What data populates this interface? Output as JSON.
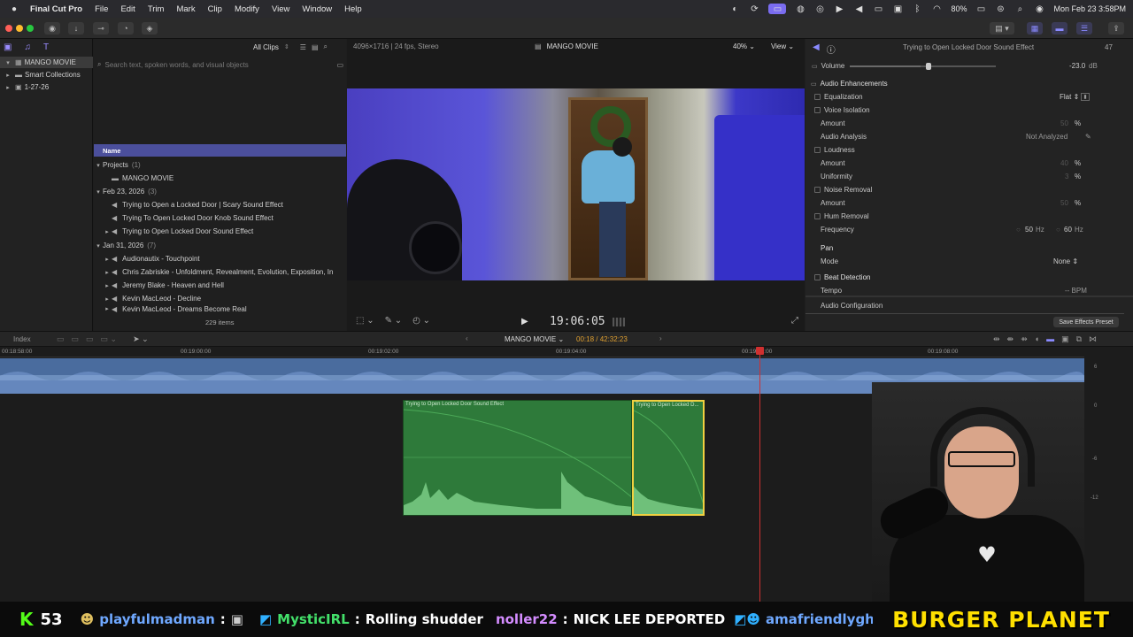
{
  "menubar": {
    "app_name": "Final Cut Pro",
    "items": [
      "File",
      "Edit",
      "Trim",
      "Mark",
      "Clip",
      "Modify",
      "View",
      "Window",
      "Help"
    ],
    "battery": "80%",
    "datetime": "Mon Feb 23  3:58PM"
  },
  "library": {
    "name": "MANGO MOVIE",
    "items": [
      "Smart Collections",
      "1-27-26"
    ]
  },
  "browser": {
    "filter_label": "All Clips",
    "search_placeholder": "Search text, spoken words, and visual objects",
    "column_header": "Name",
    "item_count": "229 items",
    "groups": [
      {
        "title": "Projects",
        "count": "(1)",
        "items": [
          "MANGO MOVIE"
        ]
      },
      {
        "title": "Feb 23, 2026",
        "count": "(3)",
        "items": [
          "Trying to Open a Locked Door  |  Scary Sound Effect",
          "Trying To Open Locked Door Knob Sound Effect",
          "Trying to Open Locked Door Sound Effect"
        ]
      },
      {
        "title": "Jan 31, 2026",
        "count": "(7)",
        "items": [
          "Audionautix - Touchpoint",
          "Chris Zabriskie - Unfoldment, Revealment, Evolution, Exposition, In",
          "Jeremy Blake - Heaven and Hell",
          "Kevin MacLeod - Decline",
          "Kevin MacLeod - Dreams Become Real"
        ]
      }
    ]
  },
  "viewer": {
    "format": "4096×1716 | 24 fps, Stereo",
    "title": "MANGO MOVIE",
    "zoom": "40%",
    "view_label": "View",
    "timecode": "19:06:05"
  },
  "inspector": {
    "clip_title": "Trying to Open Locked Door Sound Effect",
    "clip_duration_label": "47",
    "volume_label": "Volume",
    "volume_value": "-23.0",
    "volume_unit": "dB",
    "section_enhancements": "Audio Enhancements",
    "equalization": "Equalization",
    "equalization_value": "Flat",
    "voice_isolation": "Voice Isolation",
    "amount": "Amount",
    "voice_amount": "50",
    "percent": "%",
    "audio_analysis": "Audio Analysis",
    "audio_analysis_value": "Not Analyzed",
    "loudness": "Loudness",
    "loudness_amount": "40",
    "uniformity": "Uniformity",
    "uniformity_value": "3",
    "noise_removal": "Noise Removal",
    "noise_amount": "50",
    "hum_removal": "Hum Removal",
    "frequency": "Frequency",
    "freq_50": "50",
    "freq_60": "60",
    "hz": "Hz",
    "pan": "Pan",
    "mode": "Mode",
    "mode_value": "None",
    "beat_detection": "Beat Detection",
    "tempo": "Tempo",
    "tempo_value": "-- BPM",
    "audio_configuration": "Audio Configuration",
    "save_preset": "Save Effects Preset"
  },
  "timeline": {
    "index_label": "Index",
    "project_name": "MANGO MOVIE",
    "position": "00:18 / 42:32:23",
    "ruler": [
      "00:18:58:00",
      "00:19:00:00",
      "00:19:02:00",
      "00:19:04:00",
      "00:19:06:00",
      "00:19:08:00"
    ],
    "clip1_name": "Trying to Open Locked Door Sound Effect",
    "clip2_name": "Trying to Open Locked D...",
    "meter_labels": [
      "6",
      "0",
      "-6",
      "-12"
    ]
  },
  "chat": {
    "count": "53",
    "messages": [
      {
        "user": "playfulmadman",
        "text": "",
        "color": "#6fa8ff"
      },
      {
        "user": "MysticIRL",
        "text": "Rolling shudder",
        "color": "#43e06a"
      },
      {
        "user": "noller22",
        "text": "NICK LEE DEPORTED",
        "color": "#d48cff"
      },
      {
        "user": "amafriendlyghost",
        "text": "",
        "color": "#6fa8ff"
      }
    ],
    "brand": "BURGER PLANET"
  }
}
